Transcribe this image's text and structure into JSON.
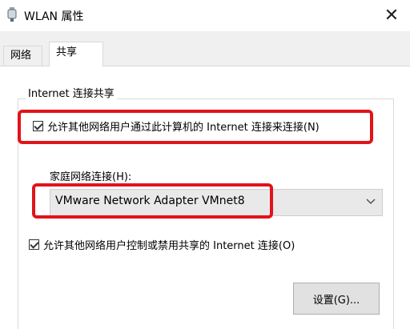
{
  "window": {
    "title": "WLAN 属性",
    "close_label": "✕"
  },
  "tabs": [
    {
      "label": "网络",
      "active": false
    },
    {
      "label": "共享",
      "active": true
    }
  ],
  "group": {
    "legend": "Internet 连接共享"
  },
  "checkbox_allow_connect": {
    "label": "允许其他网络用户通过此计算机的 Internet 连接来连接(N)",
    "checked": true
  },
  "home_network": {
    "label": "家庭网络连接(H):",
    "selected_value": "VMware Network Adapter VMnet8"
  },
  "checkbox_allow_control": {
    "label": "允许其他网络用户控制或禁用共享的 Internet 连接(O)",
    "checked": true
  },
  "settings_button": {
    "label": "设置(G)..."
  },
  "colors": {
    "highlight": "#e0141a",
    "panel_bg": "#ffffff",
    "window_bg": "#f0f0f0"
  }
}
